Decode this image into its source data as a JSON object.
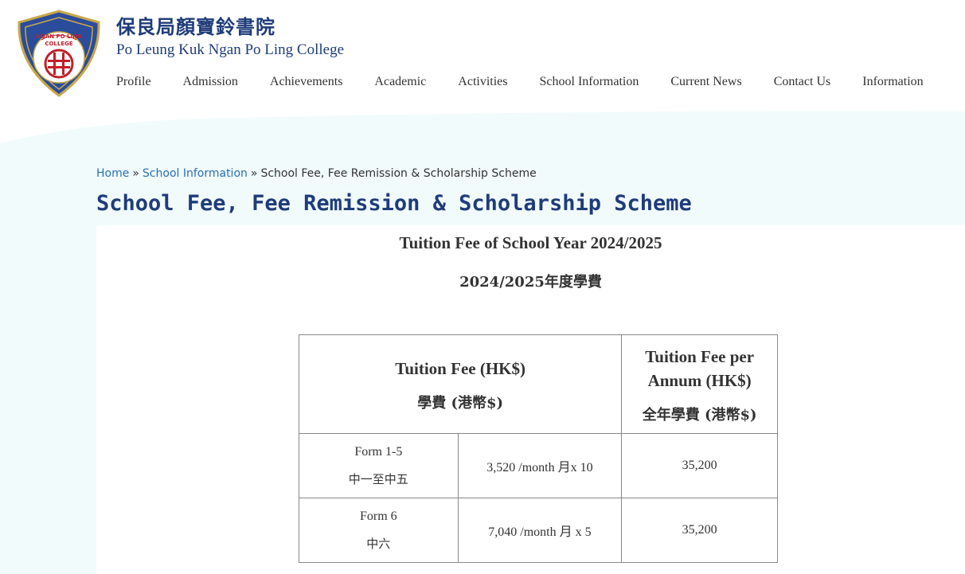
{
  "header": {
    "school_name_cn": "保良局顏寶鈴書院",
    "school_name_en": "Po Leung Kuk Ngan Po Ling College",
    "logo_text": "NGAN PO LING COLLEGE"
  },
  "nav": {
    "items": [
      "Profile",
      "Admission",
      "Achievements",
      "Academic",
      "Activities",
      "School Information",
      "Current News",
      "Contact Us",
      "Information"
    ]
  },
  "breadcrumb": {
    "home": "Home",
    "sep": "»",
    "section": "School Information",
    "current": "School Fee, Fee Remission & Scholarship Scheme"
  },
  "page": {
    "title": "School Fee, Fee Remission & Scholarship Scheme",
    "fee_title_en": "Tuition Fee of School Year 2024/2025",
    "fee_title_cn": "2024/2025年度學費"
  },
  "table": {
    "header": {
      "col1_en": "Tuition Fee (HK$)",
      "col1_cn": "學費 (港幣$)",
      "col2_en_line1": "Tuition Fee per",
      "col2_en_line2": "Annum (HK$)",
      "col2_cn": "全年學費 (港幣$)"
    },
    "rows": [
      {
        "form_en": "Form 1-5",
        "form_cn": "中一至中五",
        "monthly": "3,520 /month 月x 10",
        "annual": "35,200"
      },
      {
        "form_en": "Form 6",
        "form_cn": "中六",
        "monthly": "7,040 /month 月 x 5",
        "annual": "35,200"
      }
    ]
  },
  "colors": {
    "brand_blue": "#1f3c7a",
    "link_blue": "#2a6fb5",
    "bg_cyan": "#f1fbfc"
  }
}
